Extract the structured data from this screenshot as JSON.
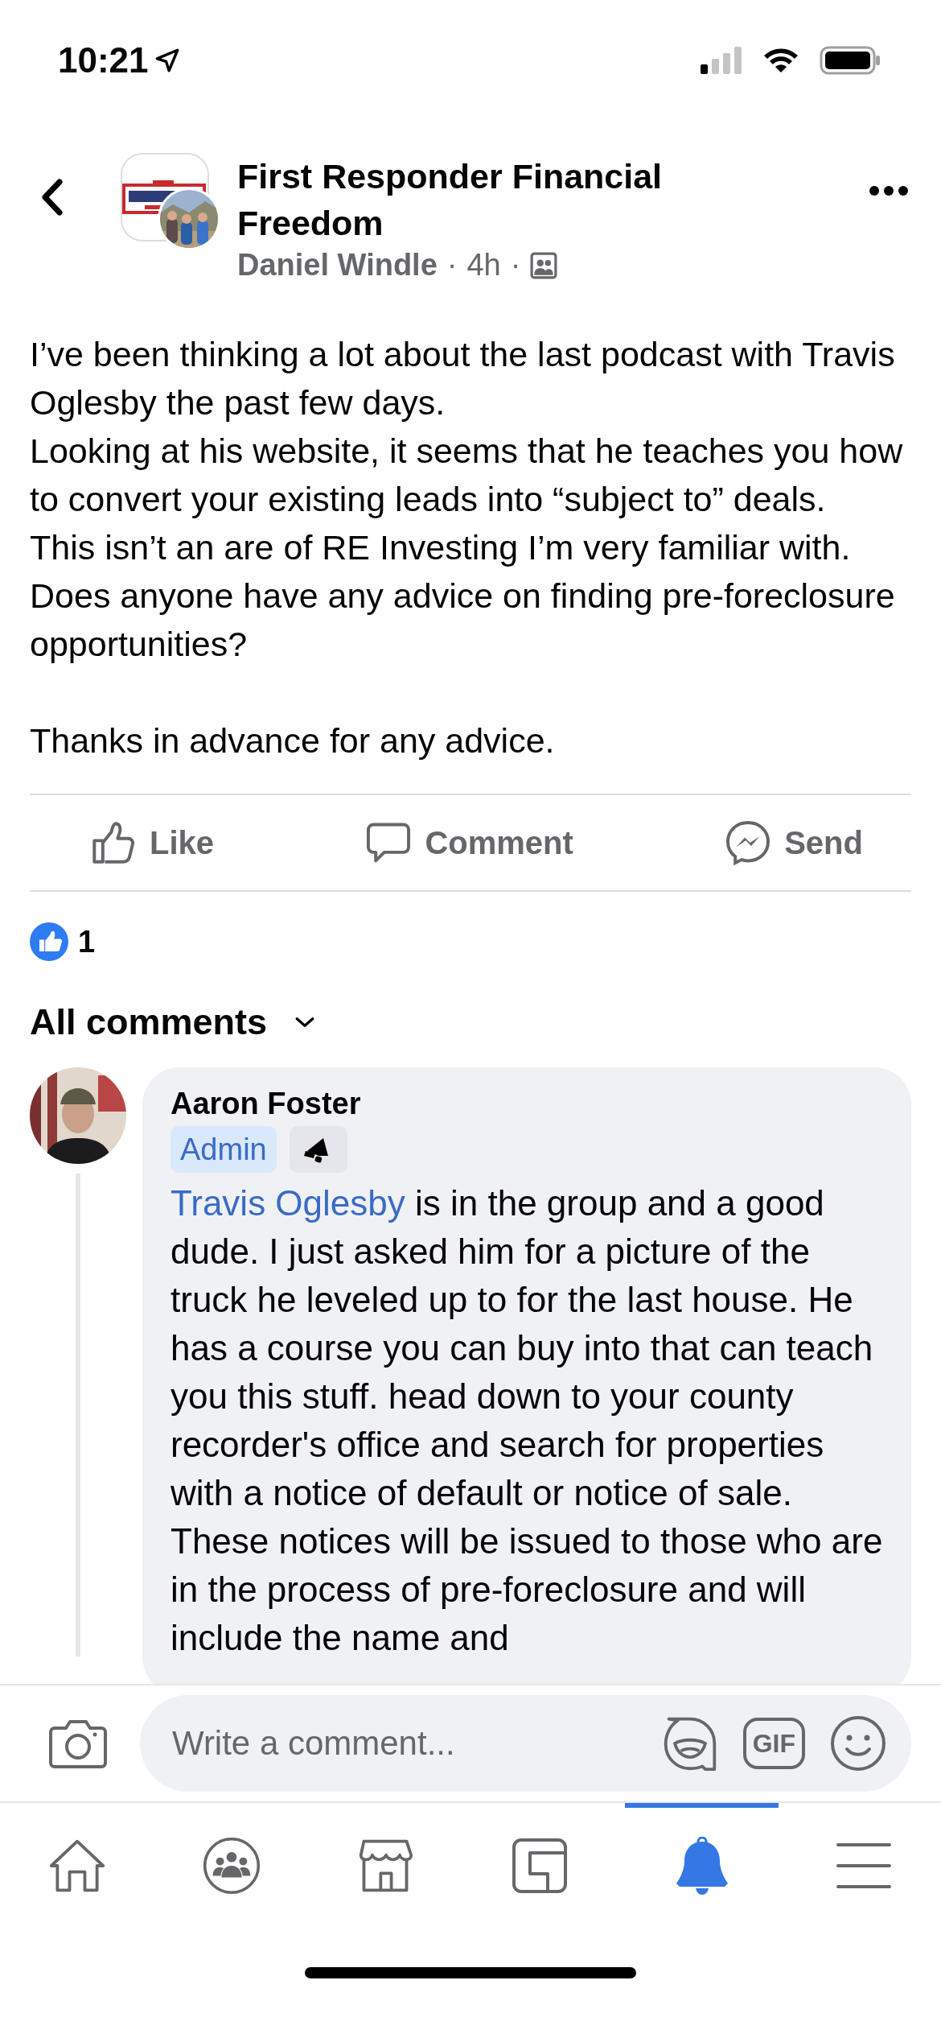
{
  "status_bar": {
    "time": "10:21"
  },
  "header": {
    "group_name": "First Responder Financial Freedom",
    "author": "Daniel Windle",
    "separator_1": "·",
    "time": "4h",
    "separator_2": "·"
  },
  "post": {
    "paragraphs": [
      "I’ve been thinking a lot about the last podcast with Travis Oglesby the past few days.",
      "Looking at his website, it seems that he teaches you how to convert your existing leads into “subject to” deals.",
      "This isn’t an are of RE Investing I’m very familiar with.",
      "Does anyone have any advice on finding pre-foreclosure opportunities?"
    ],
    "closing": "Thanks in advance for any advice."
  },
  "actions": [
    {
      "kind": "like",
      "label": "Like"
    },
    {
      "kind": "comment",
      "label": "Comment"
    },
    {
      "kind": "send",
      "label": "Send"
    }
  ],
  "reactions": {
    "count": "1"
  },
  "comments_filter": {
    "label": "All comments"
  },
  "comments": [
    {
      "author": "Aaron Foster",
      "badges": [
        {
          "kind": "role",
          "label": "Admin"
        },
        {
          "kind": "megaphone"
        }
      ],
      "mention": "Travis Oglesby",
      "text": " is in the group and a good dude. I just asked him for a picture of the truck he leveled up to for the last house. He has a course you can buy into that can teach you this stuff. head down to your county recorder's office and search for properties with a notice of default or notice of sale. These notices will be issued to those who are in the process of pre-foreclosure and will include the name and"
    }
  ],
  "composer": {
    "placeholder": "Write a comment...",
    "gif": "GIF"
  },
  "nav": [
    {
      "kind": "home",
      "selected": false
    },
    {
      "kind": "groups",
      "selected": false
    },
    {
      "kind": "marketplace",
      "selected": false
    },
    {
      "kind": "feeds",
      "selected": false
    },
    {
      "kind": "notifications",
      "selected": true
    },
    {
      "kind": "menu",
      "selected": false
    }
  ]
}
